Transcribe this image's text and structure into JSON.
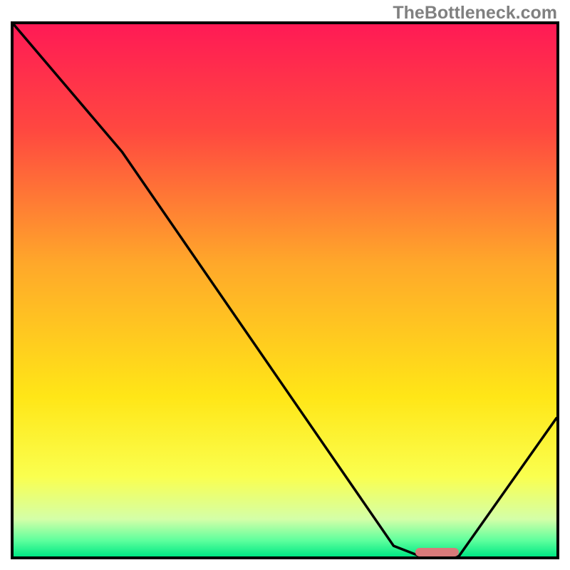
{
  "watermark": "TheBottleneck.com",
  "chart_data": {
    "type": "line",
    "title": "",
    "xlabel": "",
    "ylabel": "",
    "xlim": [
      0,
      100
    ],
    "ylim": [
      0,
      100
    ],
    "grid": false,
    "legend": false,
    "background": {
      "type": "vertical-gradient",
      "stops": [
        {
          "pos": 0.0,
          "color": "#ff1a55"
        },
        {
          "pos": 0.2,
          "color": "#ff4840"
        },
        {
          "pos": 0.45,
          "color": "#ffa82a"
        },
        {
          "pos": 0.7,
          "color": "#ffe617"
        },
        {
          "pos": 0.85,
          "color": "#faff4f"
        },
        {
          "pos": 0.93,
          "color": "#d4ffa8"
        },
        {
          "pos": 0.97,
          "color": "#5eff9d"
        },
        {
          "pos": 1.0,
          "color": "#00e884"
        }
      ]
    },
    "series": [
      {
        "name": "curve",
        "color": "#000000",
        "x": [
          0,
          20,
          70,
          75,
          82,
          100
        ],
        "y": [
          100,
          76,
          2,
          0,
          0,
          26
        ]
      }
    ],
    "marker": {
      "name": "optimal-range",
      "shape": "rounded-bar",
      "color": "#d97a7a",
      "x_center": 78,
      "y": 0.8,
      "width_pct": 8,
      "height_pct": 1.6
    }
  }
}
